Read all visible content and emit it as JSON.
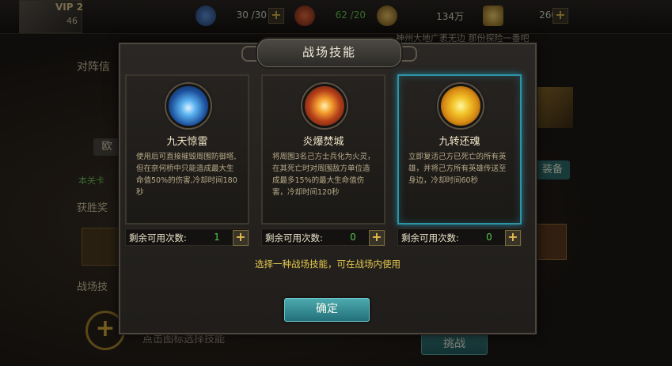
{
  "hud": {
    "vip": "VIP 2",
    "level": "46",
    "stamina": "30 /30",
    "energy": "62 /20",
    "gold": "134万",
    "ingots": "260",
    "marquee": "神州大地广袤无边 那份探险一番吧"
  },
  "background": {
    "lineup_title": "对阵信",
    "lp_button": "欧",
    "lp_green_text": "本关卡",
    "victory_title": "获胜奖",
    "battle_skill_title": "战场技",
    "hint": "点击图标选择技能",
    "equip_button": "装备",
    "challenge_button": "挑战"
  },
  "modal": {
    "title": "战场技能",
    "instruction": "选择一种战场技能，可在战场内使用",
    "confirm_label": "确定",
    "skills": [
      {
        "name": "九天惊雷",
        "description": "使用后可直接摧毁周围防御塔,但在奈何桥中只能造成最大生命值50%的伤害,冷却时间180秒",
        "counter_label": "剩余可用次数:",
        "remaining": "1",
        "selected": false
      },
      {
        "name": "炎爆焚城",
        "description": "将周围3名己方士兵化为火灵，在其死亡时对周围敌方单位造成最多15%的最大生命值伤害，冷却时间120秒",
        "counter_label": "剩余可用次数:",
        "remaining": "0",
        "selected": false
      },
      {
        "name": "九转还魂",
        "description": "立即复活己方已死亡的所有英雄，并将己方所有英雄传送至身边，冷却时间60秒",
        "counter_label": "剩余可用次数:",
        "remaining": "0",
        "selected": true
      }
    ]
  },
  "colors": {
    "accent_teal": "#2f93a8",
    "gold_text": "#e5c94e",
    "count_green": "#56c34c"
  }
}
